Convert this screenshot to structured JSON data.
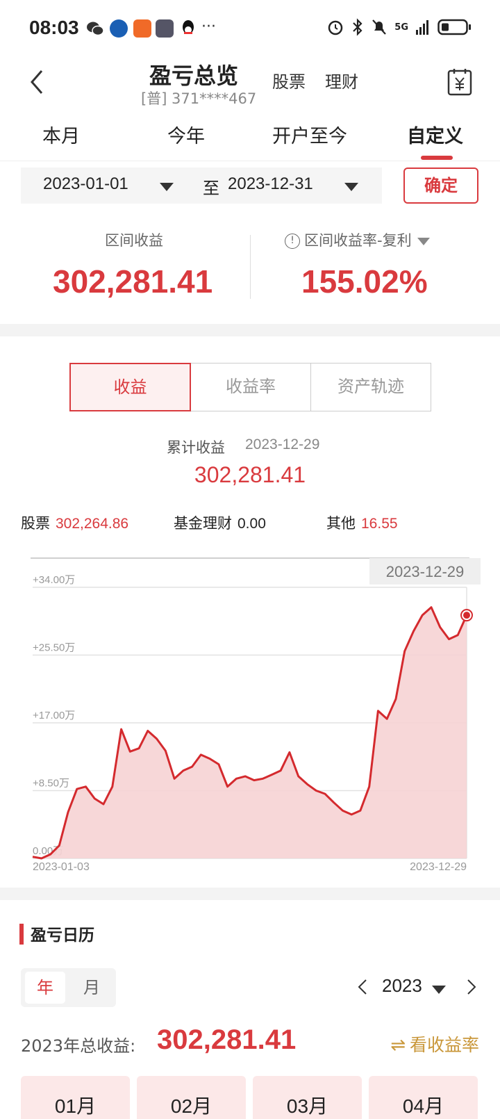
{
  "status_bar": {
    "time": "08:03",
    "network": "5G",
    "more": "···"
  },
  "header": {
    "title": "盈亏总览",
    "account": "[普] 371****467",
    "links": [
      "股票",
      "理财"
    ]
  },
  "period_tabs": [
    {
      "label": "本月",
      "active": false
    },
    {
      "label": "今年",
      "active": false
    },
    {
      "label": "开户至今",
      "active": false
    },
    {
      "label": "自定义",
      "active": true
    }
  ],
  "date_range": {
    "start": "2023-01-01",
    "separator": "至",
    "end": "2023-12-31",
    "confirm_label": "确定"
  },
  "summary": {
    "profit_label": "区间收益",
    "profit_value": "302,281.41",
    "rate_label": "区间收益率-复利",
    "rate_value": "155.02%"
  },
  "segments": [
    {
      "label": "收益",
      "active": true
    },
    {
      "label": "收益率",
      "active": false
    },
    {
      "label": "资产轨迹",
      "active": false
    }
  ],
  "cumulative": {
    "label": "累计收益",
    "date": "2023-12-29",
    "value": "302,281.41"
  },
  "breakdown": [
    {
      "label": "股票",
      "value": "302,264.86",
      "color": "#d93a3e"
    },
    {
      "label": "基金理财",
      "value": "0.00",
      "color": "#222222"
    },
    {
      "label": "其他",
      "value": "16.55",
      "color": "#d93a3e"
    }
  ],
  "chart_data": {
    "type": "area",
    "y_unit": "万",
    "ylim": [
      0,
      34
    ],
    "y_ticks": [
      "+34.00万",
      "+25.50万",
      "+17.00万",
      "+8.50万",
      "0.00万"
    ],
    "x_labels": [
      "2023-01-03",
      "2023-12-29"
    ],
    "tooltip_date": "2023-12-29",
    "grid": true,
    "line_color": "#d42a2e",
    "fill_color": "#f6d3d4",
    "series": [
      {
        "x": [
          "01-03",
          "01-10",
          "01-17",
          "01-31",
          "02-07",
          "02-14",
          "02-21",
          "02-28",
          "03-07",
          "03-14",
          "03-21",
          "03-28",
          "04-04",
          "04-11",
          "04-18",
          "04-25",
          "05-09",
          "05-16",
          "05-23",
          "05-30",
          "06-06",
          "06-13",
          "06-20",
          "06-27",
          "07-04",
          "07-11",
          "07-18",
          "07-25",
          "08-01",
          "08-08",
          "08-15",
          "08-22",
          "08-29",
          "09-05",
          "09-12",
          "09-19",
          "09-26",
          "10-10",
          "10-17",
          "10-24",
          "10-31",
          "11-07",
          "11-14",
          "11-21",
          "11-28",
          "12-05",
          "12-12",
          "12-19",
          "12-26",
          "12-29"
        ],
        "values": [
          0.2,
          0.0,
          0.5,
          1.6,
          5.8,
          8.7,
          9.0,
          7.5,
          6.8,
          9.0,
          16.2,
          13.4,
          13.8,
          16.0,
          15.0,
          13.5,
          10.0,
          11.0,
          11.5,
          13.0,
          12.5,
          11.8,
          9.0,
          10.0,
          10.3,
          9.8,
          10.0,
          10.5,
          11.0,
          13.3,
          10.3,
          9.3,
          8.5,
          8.1,
          7.0,
          6.0,
          5.5,
          6.0,
          9.0,
          18.5,
          17.5,
          20.0,
          26.0,
          28.5,
          30.5,
          31.5,
          29.0,
          27.5,
          28.0,
          30.5
        ]
      }
    ]
  },
  "calendar": {
    "title": "盈亏日历",
    "toggle": [
      "年",
      "月"
    ],
    "year": "2023",
    "total_label": "2023年总收益:",
    "total_value": "302,281.41",
    "see_rate_label": "看收益率",
    "months": [
      "01月",
      "02月",
      "03月",
      "04月"
    ]
  }
}
